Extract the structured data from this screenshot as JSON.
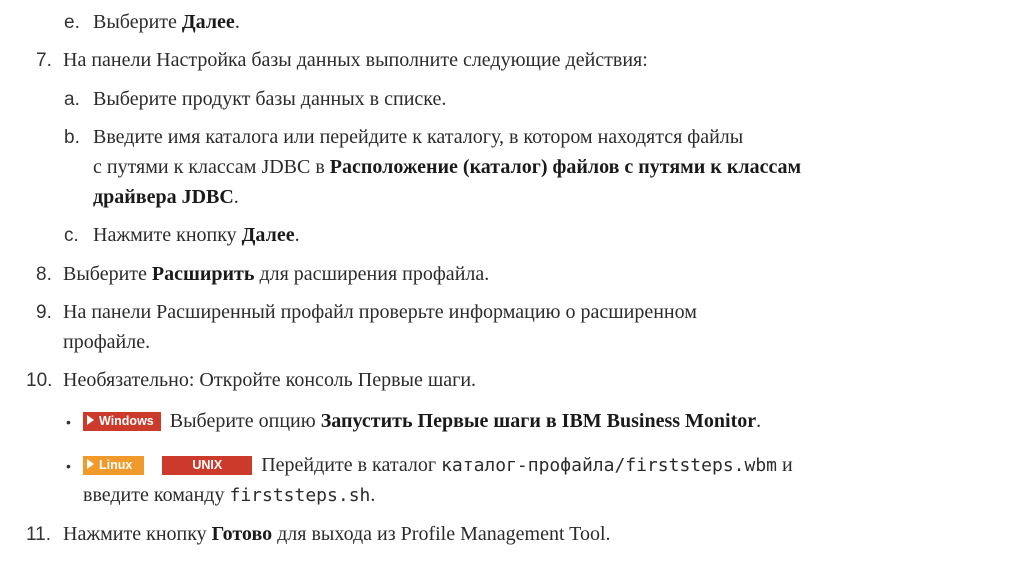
{
  "step6e": {
    "marker": "e.",
    "text": "Выберите ",
    "bold": "Далее",
    "end": "."
  },
  "step7": {
    "number": "7.",
    "text": "На панели Настройка базы данных выполните следующие действия:"
  },
  "step7a": {
    "marker": "a.",
    "text": "Выберите продукт базы данных в списке."
  },
  "step7b": {
    "marker": "b.",
    "line1": "Введите имя каталога или перейдите к каталогу, в котором находятся файлы",
    "line2_text": "с путями к классам JDBC в ",
    "line2_bold": "Расположение (каталог) файлов с путями к классам",
    "line3_bold": "драйвера JDBC",
    "line3_end": "."
  },
  "step7c": {
    "marker": "c.",
    "text": "Нажмите кнопку ",
    "bold": "Далее",
    "end": "."
  },
  "step8": {
    "number": "8.",
    "text_before": "Выберите ",
    "bold": "Расширить",
    "text_after": " для расширения профайла."
  },
  "step9": {
    "number": "9.",
    "line1": "На панели Расширенный профайл проверьте информацию о расширенном",
    "line2": "профайле."
  },
  "step10": {
    "number": "10.",
    "text": "Необязательно: Откройте консоль Первые шаги."
  },
  "bullet_windows": {
    "bullet": "•",
    "tag": "Windows",
    "text": "Выберите опцию ",
    "bold": "Запустить Первые шаги в IBM Business Monitor",
    "end": "."
  },
  "bullet_linux": {
    "bullet": "•",
    "tag_linux": "Linux",
    "tag_unix": "UNIX",
    "text": "Перейдите в каталог ",
    "mono_path": "каталог-профайла/firststeps.wbm",
    "text_and": " и",
    "line2_text": "введите команду ",
    "mono_cmd": "firststeps.sh",
    "line2_end": "."
  },
  "step11": {
    "number": "11.",
    "text": "Нажмите кнопку ",
    "bold": "Готово",
    "text_after": " для выхода из Profile Management Tool."
  },
  "colors": {
    "windows_tag": "#cc3a2b",
    "linux_tag": "#f09a2b",
    "unix_tag": "#cc3a2b"
  }
}
